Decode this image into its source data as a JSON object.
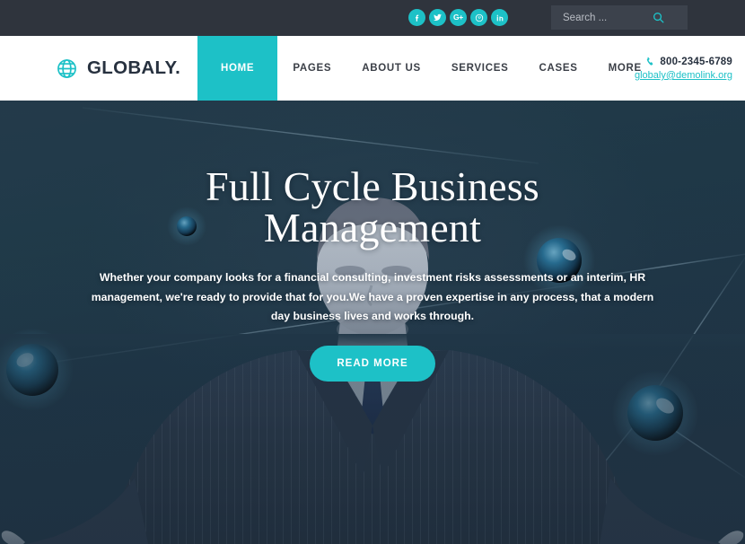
{
  "colors": {
    "accent": "#1dc1c7",
    "topbar_bg": "#2f343d",
    "search_bg": "#3c424c",
    "header_bg": "#ffffff",
    "nav_text": "#3b3f47",
    "logo_text": "#27313f",
    "hero_bg_dark": "#233b4c"
  },
  "topbar": {
    "social": [
      {
        "name": "facebook-icon",
        "label": "f"
      },
      {
        "name": "twitter-icon",
        "label": "t"
      },
      {
        "name": "google-plus-icon",
        "label": "G+"
      },
      {
        "name": "pinterest-icon",
        "label": "p"
      },
      {
        "name": "linkedin-icon",
        "label": "in"
      }
    ],
    "search": {
      "placeholder": "Search ...",
      "value": "",
      "icon": "search-icon"
    }
  },
  "header": {
    "logo": {
      "icon": "globe-icon",
      "text": "GLOBALY."
    },
    "nav": [
      {
        "label": "HOME",
        "active": true
      },
      {
        "label": "PAGES",
        "active": false
      },
      {
        "label": "ABOUT US",
        "active": false
      },
      {
        "label": "SERVICES",
        "active": false
      },
      {
        "label": "CASES",
        "active": false
      },
      {
        "label": "MORE",
        "active": false
      }
    ],
    "contact": {
      "phone_icon": "phone-icon",
      "phone": "800-2345-6789",
      "email": "globaly@demolink.org"
    }
  },
  "hero": {
    "title_line1": "Full Cycle Business",
    "title_line2": "Management",
    "paragraph": "Whether your company looks for a financial consulting, investment risks assessments or an interim, HR management, we're ready to provide that for you.We have a proven expertise in any process, that a modern day business lives and works through.",
    "cta_label": "READ MORE"
  }
}
